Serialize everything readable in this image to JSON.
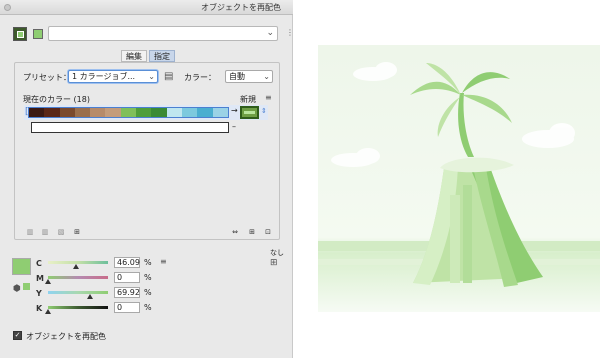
{
  "window": {
    "title": "オブジェクトを再配色"
  },
  "tabs": [
    {
      "label": "編集",
      "active": false
    },
    {
      "label": "指定",
      "active": true
    }
  ],
  "preset": {
    "label": "プリセット：",
    "value": "1 カラージョブ..."
  },
  "colors_control": {
    "label": "カラー：",
    "value": "自動"
  },
  "current_colors": {
    "label": "現在のカラー (18)",
    "new_label": "新規"
  },
  "color_segments": [
    "#3b1a14",
    "#5a2718",
    "#7a4a2e",
    "#9a6f4d",
    "#b68b6a",
    "#c39c7b",
    "#7fbf5a",
    "#4f9e3a",
    "#3a8a35",
    "#bfe6ef",
    "#7cc9de",
    "#4aaed0",
    "#9ad2e6"
  ],
  "cmyk": [
    {
      "channel": "C",
      "value": "46.09",
      "unit": "%",
      "level": 0.46
    },
    {
      "channel": "M",
      "value": "0",
      "unit": "%",
      "level": 0.0
    },
    {
      "channel": "Y",
      "value": "69.92",
      "unit": "%",
      "level": 0.7
    },
    {
      "channel": "K",
      "value": "0",
      "unit": "%",
      "level": 0.0
    }
  ],
  "none_label": "なし",
  "recolor_checkbox": {
    "label": "オブジェクトを再配色",
    "checked": true
  },
  "colors": {
    "accent": "#8fcd72",
    "selection": "#4b7fd1"
  }
}
